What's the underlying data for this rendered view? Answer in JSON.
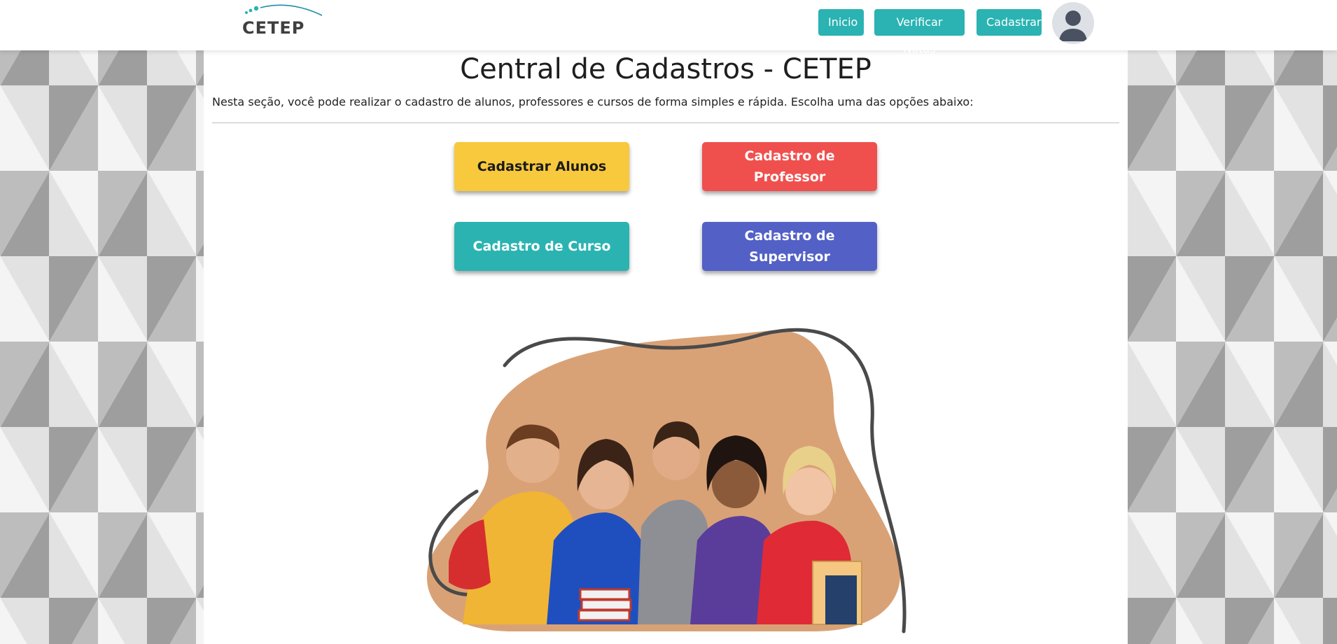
{
  "navbar": {
    "logo_text": "CETEP",
    "links": {
      "inicio": "Inicio",
      "verificar_notas": "Verificar Notas",
      "cadastrar": "Cadastrar"
    },
    "avatar_icon": "user-avatar-icon",
    "accent_color": "#2ab3b2"
  },
  "main": {
    "title": "Central de Cadastros - CETEP",
    "intro": "Nesta seção, você pode realizar o cadastro de alunos, professores e cursos de forma simples e rápida. Escolha uma das opções abaixo:",
    "buttons": {
      "alunos": "Cadastrar Alunos",
      "professor": "Cadastro de Professor",
      "curso": "Cadastro de Curso",
      "supervisor": "Cadastro de Supervisor"
    },
    "button_colors": {
      "alunos": "#f8c93c",
      "professor": "#ef504e",
      "curso": "#2bb3b1",
      "supervisor": "#5360c6"
    },
    "illustration": "students-group-photo"
  }
}
